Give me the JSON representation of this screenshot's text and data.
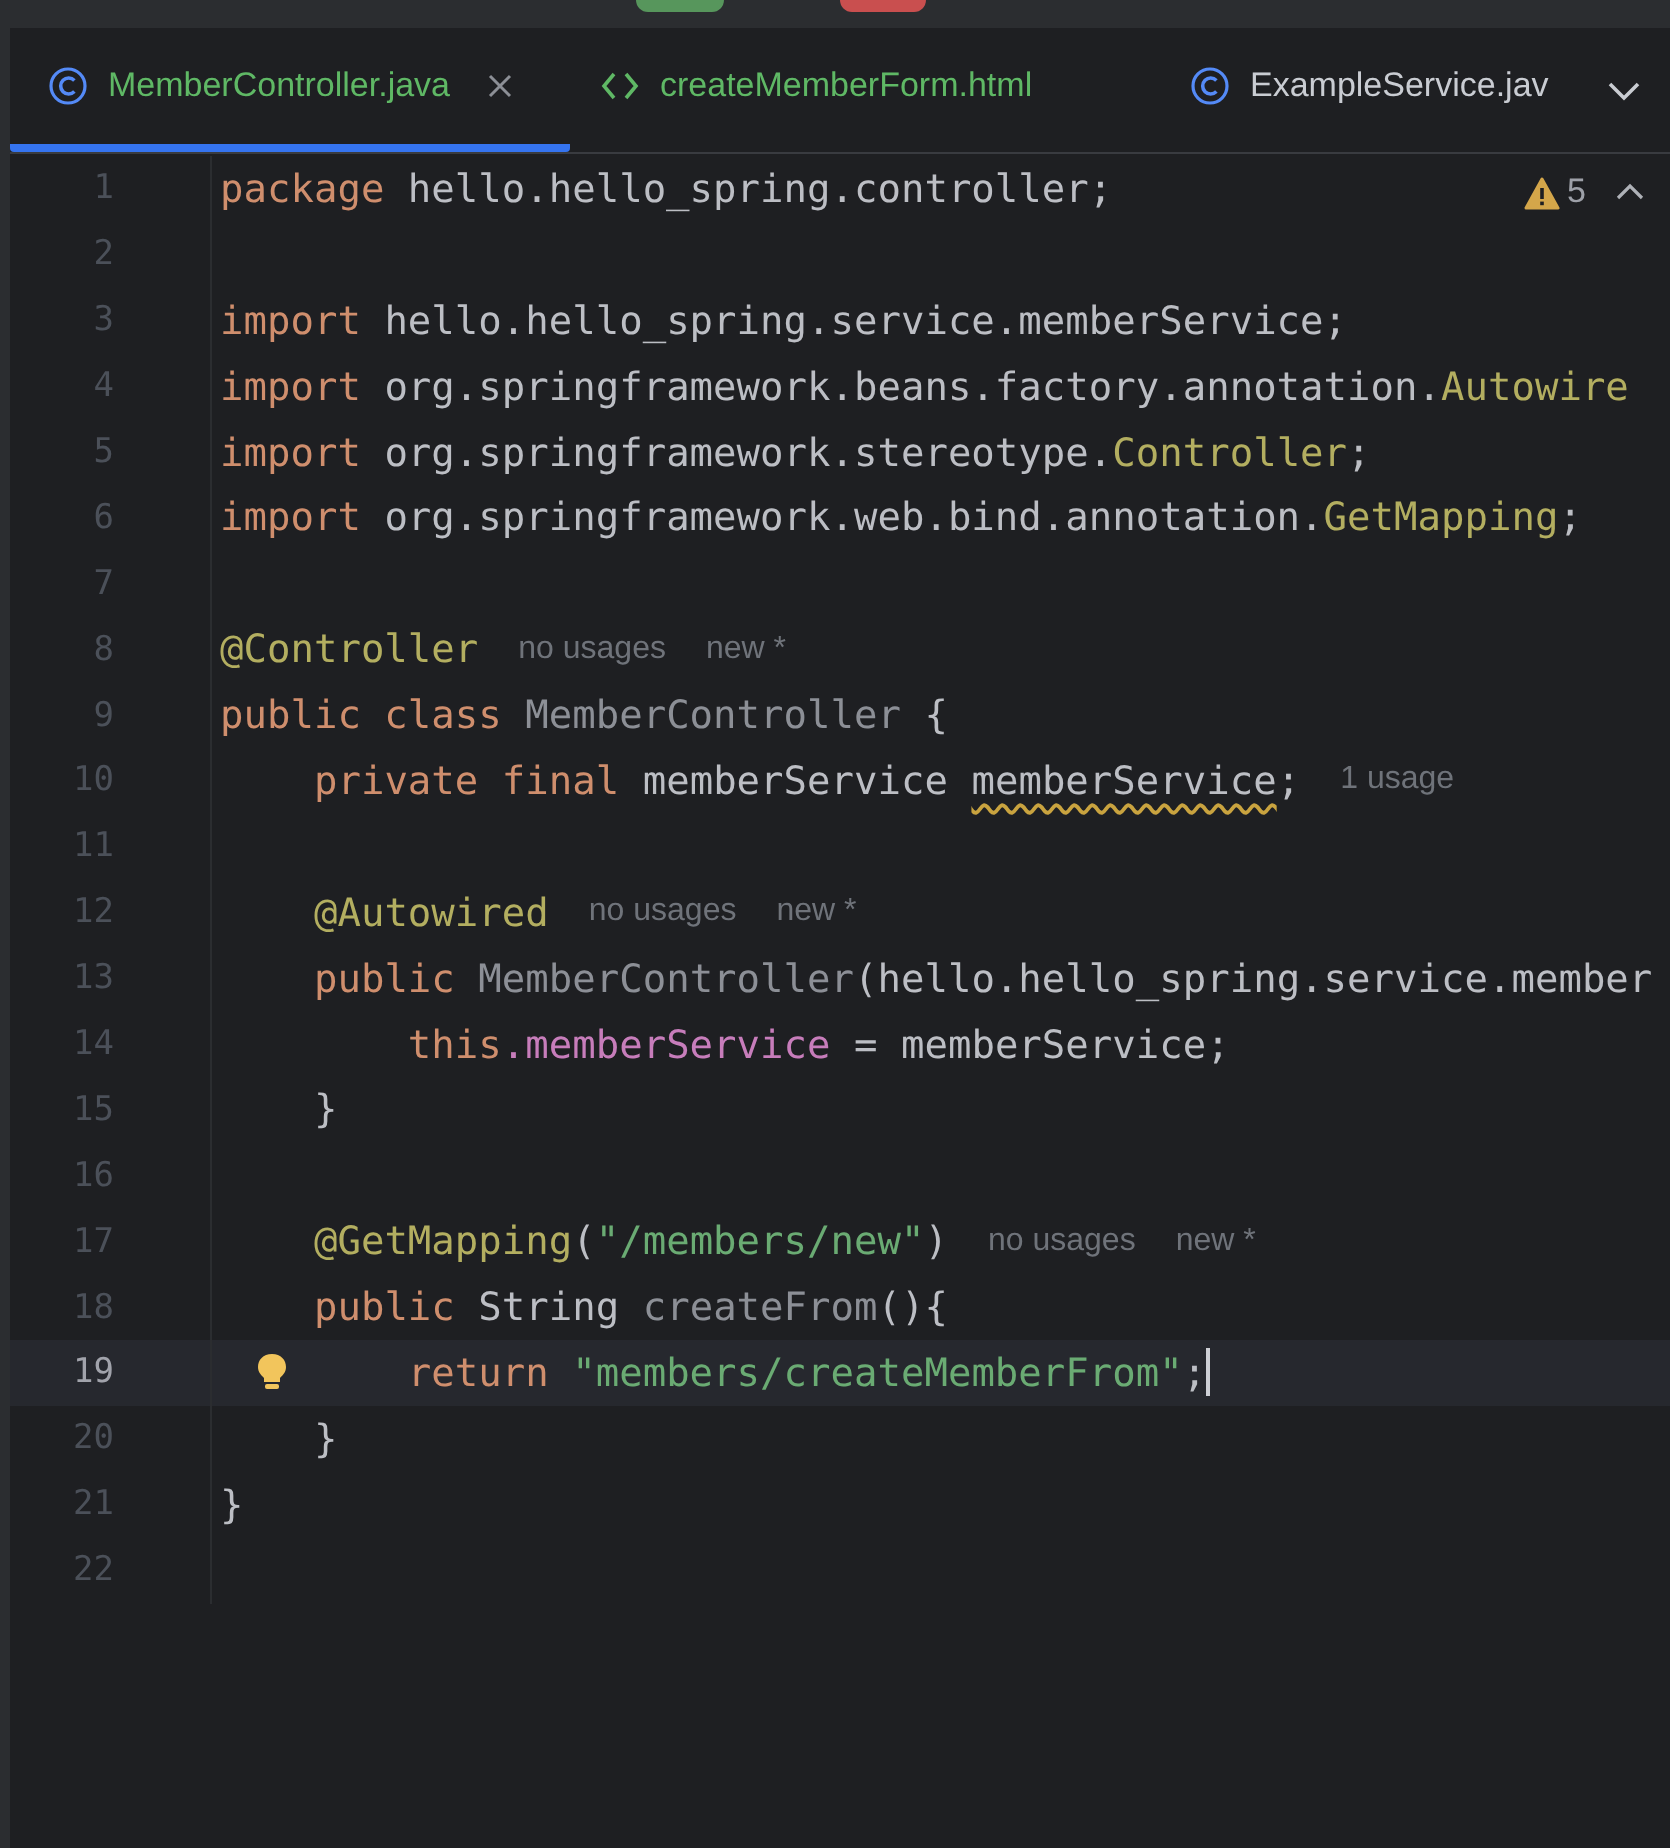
{
  "tabs": [
    {
      "label": "MemberController.java",
      "kind": "class",
      "added": true,
      "selected": true,
      "closable": true
    },
    {
      "label": "createMemberForm.html",
      "kind": "markup",
      "added": true,
      "selected": false,
      "closable": false
    },
    {
      "label": "ExampleService.jav",
      "kind": "class",
      "added": false,
      "selected": false,
      "closable": false
    }
  ],
  "problems": {
    "count": "5"
  },
  "lines": [
    {
      "number": "1",
      "current": false,
      "tokens": [
        {
          "kind": "keyword",
          "text": "package "
        },
        {
          "kind": "plain",
          "text": "hello.hello_spring.controller;"
        }
      ]
    },
    {
      "number": "2",
      "current": false
    },
    {
      "number": "3",
      "current": false,
      "tokens": [
        {
          "kind": "keyword",
          "text": "import "
        },
        {
          "kind": "plain",
          "text": "hello.hello_spring.service.memberService;"
        }
      ]
    },
    {
      "number": "4",
      "current": false,
      "tokens": [
        {
          "kind": "keyword",
          "text": "import "
        },
        {
          "kind": "plain",
          "text": "org.springframework.beans.factory.annotation."
        },
        {
          "kind": "annotation",
          "text": "Autowire"
        }
      ]
    },
    {
      "number": "5",
      "current": false,
      "tokens": [
        {
          "kind": "keyword",
          "text": "import "
        },
        {
          "kind": "plain",
          "text": "org.springframework.stereotype."
        },
        {
          "kind": "annotation",
          "text": "Controller"
        },
        {
          "kind": "plain",
          "text": ";"
        }
      ]
    },
    {
      "number": "6",
      "current": false,
      "tokens": [
        {
          "kind": "keyword",
          "text": "import "
        },
        {
          "kind": "plain",
          "text": "org.springframework.web.bind.annotation."
        },
        {
          "kind": "annotation",
          "text": "GetMapping"
        },
        {
          "kind": "plain",
          "text": ";"
        }
      ]
    },
    {
      "number": "7",
      "current": false
    },
    {
      "number": "8",
      "current": false,
      "tokens": [
        {
          "kind": "annotation",
          "text": "@Controller"
        }
      ],
      "hints": [
        "no usages",
        "new *"
      ]
    },
    {
      "number": "9",
      "current": false,
      "tokens": [
        {
          "kind": "keyword",
          "text": "public class "
        },
        {
          "kind": "unused",
          "text": "MemberController"
        },
        {
          "kind": "plain",
          "text": " {"
        }
      ]
    },
    {
      "number": "10",
      "current": false,
      "tokens": [
        {
          "kind": "keyword",
          "text": "    private final "
        },
        {
          "kind": "plain",
          "text": "memberService "
        },
        {
          "kind": "warning",
          "text": "memberService"
        },
        {
          "kind": "plain",
          "text": ";"
        }
      ],
      "hints": [
        "1 usage"
      ]
    },
    {
      "number": "11",
      "current": false
    },
    {
      "number": "12",
      "current": false,
      "tokens": [
        {
          "kind": "annotation",
          "text": "    @Autowired"
        }
      ],
      "hints": [
        "no usages",
        "new *"
      ]
    },
    {
      "number": "13",
      "current": false,
      "tokens": [
        {
          "kind": "keyword",
          "text": "    public "
        },
        {
          "kind": "unused",
          "text": "MemberController"
        },
        {
          "kind": "plain",
          "text": "(hello.hello_spring.service.member"
        }
      ]
    },
    {
      "number": "14",
      "current": false,
      "tokens": [
        {
          "kind": "keyword",
          "text": "        this"
        },
        {
          "kind": "field",
          "text": ".memberService"
        },
        {
          "kind": "plain",
          "text": " = memberService;"
        }
      ]
    },
    {
      "number": "15",
      "current": false,
      "tokens": [
        {
          "kind": "plain",
          "text": "    }"
        }
      ]
    },
    {
      "number": "16",
      "current": false
    },
    {
      "number": "17",
      "current": false,
      "tokens": [
        {
          "kind": "annotation",
          "text": "    @GetMapping"
        },
        {
          "kind": "plain",
          "text": "("
        },
        {
          "kind": "string",
          "text": "\"/members/new\""
        },
        {
          "kind": "plain",
          "text": ")"
        }
      ],
      "hints": [
        "no usages",
        "new *"
      ]
    },
    {
      "number": "18",
      "current": false,
      "tokens": [
        {
          "kind": "keyword",
          "text": "    public "
        },
        {
          "kind": "plain",
          "text": "String "
        },
        {
          "kind": "unused",
          "text": "createFrom"
        },
        {
          "kind": "plain",
          "text": "(){"
        }
      ]
    },
    {
      "number": "19",
      "current": true,
      "tokens": [
        {
          "kind": "keyword",
          "text": "        return "
        },
        {
          "kind": "string",
          "text": "\"members/createMemberFrom\""
        },
        {
          "kind": "plain",
          "text": ";"
        }
      ]
    },
    {
      "number": "20",
      "current": false,
      "tokens": [
        {
          "kind": "plain",
          "text": "    }"
        }
      ]
    },
    {
      "number": "21",
      "current": false,
      "tokens": [
        {
          "kind": "plain",
          "text": "}"
        }
      ]
    },
    {
      "number": "22",
      "current": false
    }
  ]
}
